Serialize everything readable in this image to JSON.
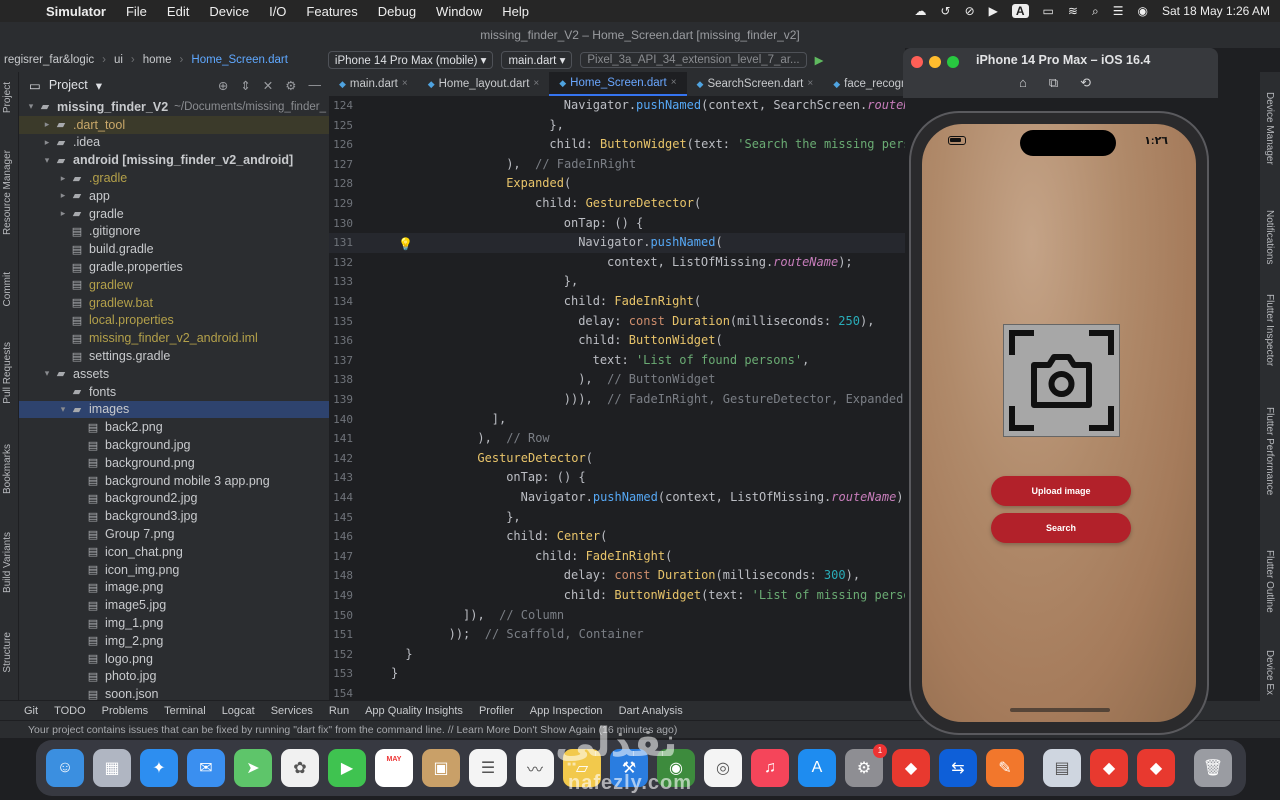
{
  "menubar": {
    "app": "Simulator",
    "items": [
      "File",
      "Edit",
      "Device",
      "I/O",
      "Features",
      "Debug",
      "Window",
      "Help"
    ],
    "datetime": "Sat 18 May  1:26 AM",
    "input_source": "A"
  },
  "titlebar": {
    "title": "missing_finder_V2 – Home_Screen.dart [missing_finder_v2]"
  },
  "toolbar": {
    "crumbs": [
      "regisrer_far&logic",
      "ui",
      "home",
      "Home_Screen.dart"
    ],
    "device": "iPhone 14 Pro Max (mobile)",
    "config": "main.dart",
    "emulator": "Pixel_3a_API_34_extension_level_7_ar..."
  },
  "left_strip": [
    "Project",
    "Resource Manager",
    "Commit",
    "Pull Requests",
    "Bookmarks",
    "Build Variants",
    "Structure"
  ],
  "right_strip": [
    "Device Manager",
    "Notifications",
    "Flutter Inspector",
    "Flutter Performance",
    "Flutter Outline",
    "Device Ex"
  ],
  "project": {
    "header": "Project",
    "tree": [
      {
        "name": "missing_finder_V2",
        "suffix": "~/Documents/missing_finder_",
        "depth": 0,
        "arrow": "▾",
        "kind": "root"
      },
      {
        "name": ".dart_tool",
        "depth": 1,
        "arrow": "▸",
        "kind": "folder-hl"
      },
      {
        "name": ".idea",
        "depth": 1,
        "arrow": "▸",
        "kind": "folder"
      },
      {
        "name": "android [missing_finder_v2_android]",
        "depth": 1,
        "arrow": "▾",
        "kind": "folder-bold"
      },
      {
        "name": ".gradle",
        "depth": 2,
        "arrow": "▸",
        "kind": "folder-olive"
      },
      {
        "name": "app",
        "depth": 2,
        "arrow": "▸",
        "kind": "folder"
      },
      {
        "name": "gradle",
        "depth": 2,
        "arrow": "▸",
        "kind": "folder"
      },
      {
        "name": ".gitignore",
        "depth": 2,
        "arrow": "",
        "kind": "file"
      },
      {
        "name": "build.gradle",
        "depth": 2,
        "arrow": "",
        "kind": "file"
      },
      {
        "name": "gradle.properties",
        "depth": 2,
        "arrow": "",
        "kind": "file"
      },
      {
        "name": "gradlew",
        "depth": 2,
        "arrow": "",
        "kind": "file-olive"
      },
      {
        "name": "gradlew.bat",
        "depth": 2,
        "arrow": "",
        "kind": "file-olive"
      },
      {
        "name": "local.properties",
        "depth": 2,
        "arrow": "",
        "kind": "file-olive"
      },
      {
        "name": "missing_finder_v2_android.iml",
        "depth": 2,
        "arrow": "",
        "kind": "file-olive"
      },
      {
        "name": "settings.gradle",
        "depth": 2,
        "arrow": "",
        "kind": "file"
      },
      {
        "name": "assets",
        "depth": 1,
        "arrow": "▾",
        "kind": "folder"
      },
      {
        "name": "fonts",
        "depth": 2,
        "arrow": "",
        "kind": "folder"
      },
      {
        "name": "images",
        "depth": 2,
        "arrow": "▾",
        "kind": "folder-sel"
      },
      {
        "name": "back2.png",
        "depth": 3,
        "arrow": "",
        "kind": "file"
      },
      {
        "name": "background.jpg",
        "depth": 3,
        "arrow": "",
        "kind": "file"
      },
      {
        "name": "background.png",
        "depth": 3,
        "arrow": "",
        "kind": "file"
      },
      {
        "name": "background mobile 3 app.png",
        "depth": 3,
        "arrow": "",
        "kind": "file"
      },
      {
        "name": "background2.jpg",
        "depth": 3,
        "arrow": "",
        "kind": "file"
      },
      {
        "name": "background3.jpg",
        "depth": 3,
        "arrow": "",
        "kind": "file"
      },
      {
        "name": "Group 7.png",
        "depth": 3,
        "arrow": "",
        "kind": "file"
      },
      {
        "name": "icon_chat.png",
        "depth": 3,
        "arrow": "",
        "kind": "file"
      },
      {
        "name": "icon_img.png",
        "depth": 3,
        "arrow": "",
        "kind": "file"
      },
      {
        "name": "image.png",
        "depth": 3,
        "arrow": "",
        "kind": "file"
      },
      {
        "name": "image5.jpg",
        "depth": 3,
        "arrow": "",
        "kind": "file"
      },
      {
        "name": "img_1.png",
        "depth": 3,
        "arrow": "",
        "kind": "file"
      },
      {
        "name": "img_2.png",
        "depth": 3,
        "arrow": "",
        "kind": "file"
      },
      {
        "name": "logo.png",
        "depth": 3,
        "arrow": "",
        "kind": "file"
      },
      {
        "name": "photo.jpg",
        "depth": 3,
        "arrow": "",
        "kind": "file"
      },
      {
        "name": "soon.json",
        "depth": 3,
        "arrow": "",
        "kind": "file"
      }
    ]
  },
  "editor": {
    "tabs": [
      "main.dart",
      "Home_layout.dart",
      "Home_Screen.dart",
      "SearchScreen.dart",
      "face_recogniti"
    ],
    "active_tab": 2,
    "current_line": "131",
    "lines": [
      {
        "n": "124",
        "indent": 12,
        "segs": [
          [
            "",
            "Navigator."
          ],
          [
            "fn",
            "pushNamed"
          ],
          [
            "",
            "(context, SearchScreen."
          ],
          [
            "prop",
            "routeName"
          ],
          [
            "",
            ");"
          ]
        ]
      },
      {
        "n": "125",
        "indent": 11,
        "segs": [
          [
            "",
            "},"
          ]
        ]
      },
      {
        "n": "126",
        "indent": 11,
        "segs": [
          [
            "",
            "child: "
          ],
          [
            "cls",
            "ButtonWidget"
          ],
          [
            "",
            "(text: "
          ],
          [
            "str",
            "'Search the missing perso"
          ]
        ]
      },
      {
        "n": "127",
        "indent": 8,
        "segs": [
          [
            "",
            "),  "
          ],
          [
            "cm",
            "// FadeInRight"
          ]
        ]
      },
      {
        "n": "128",
        "indent": 8,
        "segs": [
          [
            "cls",
            "Expanded"
          ],
          [
            "",
            "("
          ]
        ]
      },
      {
        "n": "129",
        "indent": 10,
        "segs": [
          [
            "",
            "child: "
          ],
          [
            "cls",
            "GestureDetector"
          ],
          [
            "",
            "("
          ]
        ]
      },
      {
        "n": "130",
        "indent": 12,
        "segs": [
          [
            "",
            "onTap: () {"
          ]
        ]
      },
      {
        "n": "131",
        "indent": 13,
        "segs": [
          [
            "",
            "Navigator."
          ],
          [
            "fn",
            "pushNamed"
          ],
          [
            "",
            "("
          ]
        ]
      },
      {
        "n": "132",
        "indent": 15,
        "segs": [
          [
            "",
            "context, ListOfMissing."
          ],
          [
            "prop",
            "routeName"
          ],
          [
            "",
            ");"
          ]
        ]
      },
      {
        "n": "133",
        "indent": 12,
        "segs": [
          [
            "",
            "},"
          ]
        ]
      },
      {
        "n": "134",
        "indent": 12,
        "segs": [
          [
            "",
            "child: "
          ],
          [
            "cls",
            "FadeInRight"
          ],
          [
            "",
            "("
          ]
        ]
      },
      {
        "n": "135",
        "indent": 13,
        "segs": [
          [
            "",
            "delay: "
          ],
          [
            "kw",
            "const "
          ],
          [
            "cls",
            "Duration"
          ],
          [
            "",
            "(milliseconds: "
          ],
          [
            "num",
            "250"
          ],
          [
            "",
            "),"
          ]
        ]
      },
      {
        "n": "136",
        "indent": 13,
        "segs": [
          [
            "",
            "child: "
          ],
          [
            "cls",
            "ButtonWidget"
          ],
          [
            "",
            "("
          ]
        ]
      },
      {
        "n": "137",
        "indent": 14,
        "segs": [
          [
            "",
            "text: "
          ],
          [
            "str",
            "'List of found persons'"
          ],
          [
            "",
            ","
          ]
        ]
      },
      {
        "n": "138",
        "indent": 13,
        "segs": [
          [
            "",
            "),  "
          ],
          [
            "cm",
            "// ButtonWidget"
          ]
        ]
      },
      {
        "n": "139",
        "indent": 12,
        "segs": [
          [
            "",
            "))),  "
          ],
          [
            "cm",
            "// FadeInRight, GestureDetector, Expanded"
          ]
        ]
      },
      {
        "n": "140",
        "indent": 7,
        "segs": [
          [
            "",
            "],"
          ]
        ]
      },
      {
        "n": "141",
        "indent": 6,
        "segs": [
          [
            "",
            "),  "
          ],
          [
            "cm",
            "// Row"
          ]
        ]
      },
      {
        "n": "142",
        "indent": 6,
        "segs": [
          [
            "cls",
            "GestureDetector"
          ],
          [
            "",
            "("
          ]
        ]
      },
      {
        "n": "143",
        "indent": 8,
        "segs": [
          [
            "",
            "onTap: () {"
          ]
        ]
      },
      {
        "n": "144",
        "indent": 9,
        "segs": [
          [
            "",
            "Navigator."
          ],
          [
            "fn",
            "pushNamed"
          ],
          [
            "",
            "(context, ListOfMissing."
          ],
          [
            "prop",
            "routeName"
          ],
          [
            "",
            ");"
          ]
        ]
      },
      {
        "n": "145",
        "indent": 8,
        "segs": [
          [
            "",
            "},"
          ]
        ]
      },
      {
        "n": "146",
        "indent": 8,
        "segs": [
          [
            "",
            "child: "
          ],
          [
            "cls",
            "Center"
          ],
          [
            "",
            "("
          ]
        ]
      },
      {
        "n": "147",
        "indent": 10,
        "segs": [
          [
            "",
            "child: "
          ],
          [
            "cls",
            "FadeInRight"
          ],
          [
            "",
            "("
          ]
        ]
      },
      {
        "n": "148",
        "indent": 12,
        "segs": [
          [
            "",
            "delay: "
          ],
          [
            "kw",
            "const "
          ],
          [
            "cls",
            "Duration"
          ],
          [
            "",
            "(milliseconds: "
          ],
          [
            "num",
            "300"
          ],
          [
            "",
            "),"
          ]
        ]
      },
      {
        "n": "149",
        "indent": 12,
        "segs": [
          [
            "",
            "child: "
          ],
          [
            "cls",
            "ButtonWidget"
          ],
          [
            "",
            "(text: "
          ],
          [
            "str",
            "'List of missing person"
          ]
        ]
      },
      {
        "n": "150",
        "indent": 5,
        "segs": [
          [
            "",
            "]),  "
          ],
          [
            "cm",
            "// Column"
          ]
        ]
      },
      {
        "n": "151",
        "indent": 4,
        "segs": [
          [
            "",
            "));  "
          ],
          [
            "cm",
            "// Scaffold, Container"
          ]
        ]
      },
      {
        "n": "152",
        "indent": 1,
        "segs": [
          [
            "",
            "}"
          ]
        ]
      },
      {
        "n": "153",
        "indent": 0,
        "segs": [
          [
            "",
            "}"
          ]
        ]
      },
      {
        "n": "154",
        "indent": 0,
        "segs": []
      }
    ]
  },
  "bottom_tools": [
    "Git",
    "TODO",
    "Problems",
    "Terminal",
    "Logcat",
    "Services",
    "Run",
    "App Quality Insights",
    "Profiler",
    "App Inspection",
    "Dart Analysis"
  ],
  "status": {
    "message": "Your project contains issues that can be fixed by running \"dart fix\" from the command line. // Learn More   Don't Show Again (16 minutes ago)"
  },
  "simulator": {
    "title": "iPhone 14 Pro Max – iOS 16.4",
    "phone_time": "١:٢٦",
    "upload_label": "Upload image",
    "search_label": "Search"
  },
  "watermark": {
    "arabic": "نفذلي",
    "latin": "nafezly.com"
  },
  "dock": {
    "calendar_month": "MAY",
    "calendar_day": "18",
    "settings_badge": "1",
    "apps": [
      "finder",
      "launchpad",
      "safari",
      "mail",
      "maps",
      "photos",
      "facetime",
      "calendar",
      "contacts",
      "reminders",
      "freeform",
      "files",
      "xcode",
      "android-studio",
      "chrome",
      "music",
      "app-store",
      "settings",
      "anydesk",
      "teamviewer",
      "sketch",
      "preview",
      "anydesk-2",
      "anydesk-3",
      "trash"
    ]
  },
  "colors": {
    "accent": "#3574f0",
    "button_red": "#b2212a"
  }
}
